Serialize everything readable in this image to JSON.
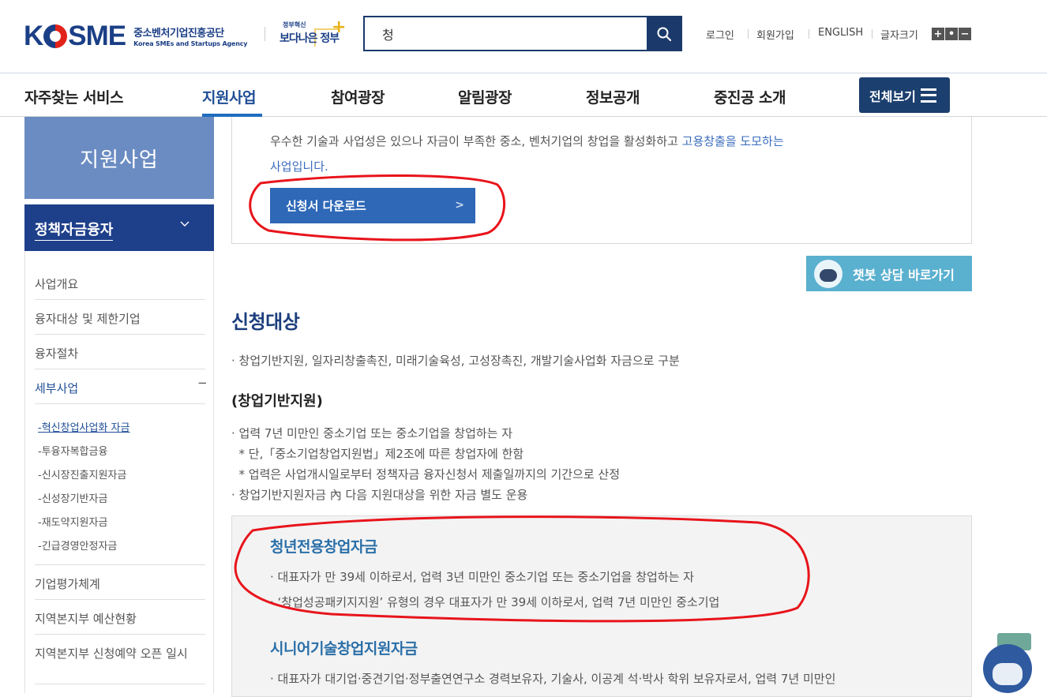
{
  "header": {
    "logo_word_left": "K",
    "logo_word_right": "SME",
    "logo_ko": "중소벤처기업진흥공단",
    "logo_en": "Korea SMEs and Startups Agency",
    "gov_small": "정부혁신",
    "gov_main": "보다나은 정부",
    "search_value": "청",
    "utility": [
      "로그인",
      "회원가입",
      "ENGLISH",
      "글자크기"
    ],
    "font_controls": [
      "+",
      "•",
      "−"
    ]
  },
  "gnb": {
    "items": [
      "자주찾는 서비스",
      "지원사업",
      "참여광장",
      "알림광장",
      "정보공개",
      "중진공 소개"
    ],
    "active": "지원사업",
    "all_button": "전체보기"
  },
  "sidebar": {
    "title": "지원사업",
    "category": "정책자금융자",
    "items": [
      "사업개요",
      "융자대상 및 제한기업",
      "융자절차",
      "세부사업"
    ],
    "sub_items": [
      "혁신창업사업화 자금",
      "투융자복합금융",
      "신시장진출지원자금",
      "신성장기반자금",
      "재도약지원자금",
      "긴급경영안정자금"
    ],
    "items_after": [
      "기업평가체계",
      "지역본지부 예산현황",
      "지역본지부 신청예약 오픈 일시"
    ],
    "expand_mark": "−"
  },
  "main": {
    "desc_part1": "우수한 기술과 사업성은 있으나 자금이 부족한 중소, 벤처기업의 창업을 활성화하고 ",
    "desc_blue": "고용창출을 도모하는",
    "desc_blue2": "사업입니다.",
    "download_button": "신청서 다운로드",
    "chatbot_button": "챗봇 상담 바로가기",
    "section_title": "신청대상",
    "section_line": "· 창업기반지원, 일자리창출촉진, 미래기술육성, 고성장촉진, 개발기술사업화 자금으로 구분",
    "sub_title": "(창업기반지원)",
    "sub_lines": [
      "· 업력 7년 미만인 중소기업 또는 중소기업을 창업하는 자",
      "  * 단,「중소기업창업지원법」제2조에 따른 창업자에 한함",
      "  * 업력은 사업개시일로부터 정책자금 융자신청서 제출일까지의 기간으로 산정",
      "· 창업기반지원자금 內 다음 지원대상을 위한 자금 별도 운용"
    ],
    "box": {
      "title1": "청년전용창업자금",
      "lines1": [
        "· 대표자가 만 39세 이하로서, 업력 3년 미만인 중소기업 또는 중소기업을 창업하는 자",
        "· ‘창업성공패키지지원’ 유형의 경우 대표자가 만 39세 이하로서, 업력 7년 미만인 중소기업"
      ],
      "title2": "시니어기술창업지원자금",
      "lines2": [
        "· 대표자가 대기업·중견기업·정부출연연구소 경력보유자, 기술사, 이공계 석·박사 학위 보유자로서, 업력 7년 미만인"
      ]
    }
  },
  "colors": {
    "brand": "#1b3f86",
    "active_nav": "#1f4e96",
    "download_btn": "#2e68b7",
    "chatbot": "#5ab0cf",
    "annotation": "#e8141b"
  },
  "icons": [
    "search-icon",
    "chevron-down-icon",
    "menu-icon",
    "arrow-right-icon",
    "chatbot-icon"
  ]
}
